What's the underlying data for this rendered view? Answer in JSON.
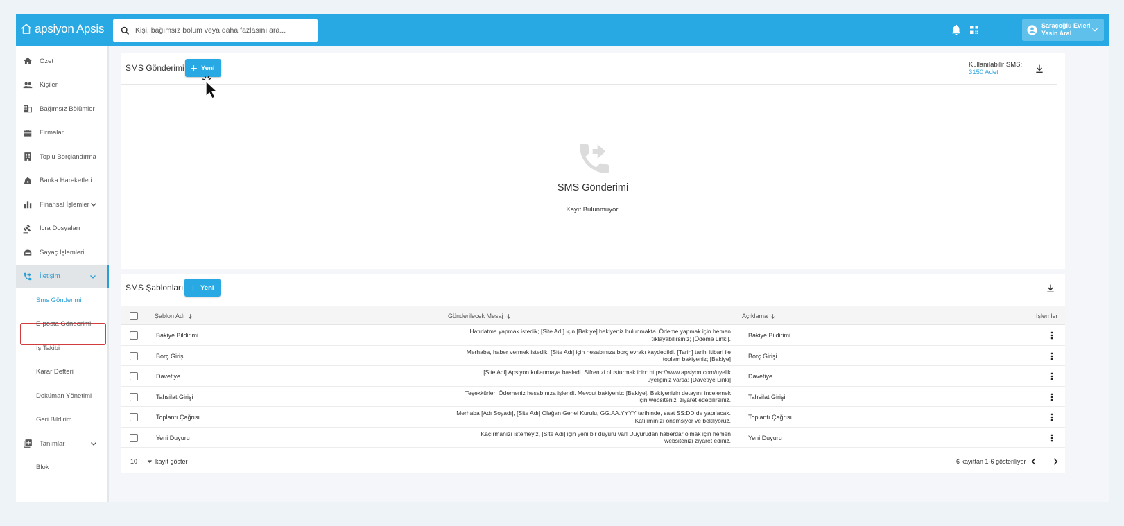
{
  "app": {
    "logo_text": "apsiyon Apsis",
    "search_placeholder": "Kişi, bağımsız bölüm veya daha fazlasını ara...",
    "site_name": "Saraçoğlu Evleri",
    "user_name": "Yasin Aral",
    "accent_color": "#29a9e3"
  },
  "sidebar": {
    "items": [
      {
        "label": "Özet",
        "icon": "home-icon"
      },
      {
        "label": "Kişiler",
        "icon": "people-icon"
      },
      {
        "label": "Bağımsız Bölümler",
        "icon": "building-icon"
      },
      {
        "label": "Firmalar",
        "icon": "briefcase-icon"
      },
      {
        "label": "Toplu Borçlandırma",
        "icon": "office-icon"
      },
      {
        "label": "Banka Hareketleri",
        "icon": "bank-icon"
      },
      {
        "label": "Finansal İşlemler",
        "icon": "chart-icon"
      },
      {
        "label": "İcra Dosyaları",
        "icon": "gavel-icon"
      },
      {
        "label": "Sayaç İşlemleri",
        "icon": "meter-icon"
      },
      {
        "label": "İletişim",
        "icon": "phone-icon"
      },
      {
        "label": "Tanımlar",
        "icon": "add-box-icon"
      }
    ],
    "sub_items": [
      {
        "label": "Sms Gönderimi"
      },
      {
        "label": "E-posta Gönderimi"
      },
      {
        "label": "İş Takibi"
      },
      {
        "label": "Karar Defteri"
      },
      {
        "label": "Doküman Yönetimi"
      },
      {
        "label": "Geri Bildirim"
      },
      {
        "label": "Blok"
      }
    ]
  },
  "sms_panel": {
    "title": "SMS Gönderimi",
    "new_label": "Yeni",
    "available_label": "Kullanılabilir SMS:",
    "available_count": "3150 Adet",
    "empty_title": "SMS Gönderimi",
    "empty_text": "Kayıt Bulunmuyor."
  },
  "templates_panel": {
    "title": "SMS Şablonları",
    "new_label": "Yeni",
    "columns": {
      "name": "Şablon Adı",
      "message": "Gönderilecek Mesaj",
      "description": "Açıklama",
      "actions": "İşlemler"
    },
    "rows": [
      {
        "name": "Bakiye Bildirimi",
        "msg1": "Hatırlatma yapmak istedik; [Site Adı] için [Bakiye] bakiyeniz bulunmakta. Ödeme yapmak için hemen",
        "msg2": "tıklayabilirsiniz; [Ödeme Linki].",
        "desc": "Bakiye Bildirimi"
      },
      {
        "name": "Borç Girişi",
        "msg1": "Merhaba, haber vermek istedik; [Site Adı] için hesabınıza borç evrakı kaydedildi. [Tarih] tarihi itibari ile",
        "msg2": "toplam bakiyeniz; [Bakiye]",
        "desc": "Borç Girişi"
      },
      {
        "name": "Davetiye",
        "msg1": "[Site Adi] Apsiyon kullanmaya basladi. Sifrenizi olusturmak icin: https://www.apsiyon.com/uyelik",
        "msg2": "uyeliginiz varsa: [Davetiye Linki]",
        "desc": "Davetiye"
      },
      {
        "name": "Tahsilat Girişi",
        "msg1": "Teşekkürler! Ödemeniz hesabınıza işlendi. Mevcut bakiyeniz: [Bakiye]. Bakiyenizin detayını incelemek",
        "msg2": "için websitenizi ziyaret edebilirsiniz.",
        "desc": "Tahsilat Girişi"
      },
      {
        "name": "Toplantı Çağrısı",
        "msg1": "Merhaba [Adı Soyadı], [Site Adı] Olağan Genel Kurulu, GG.AA.YYYY tarihinde, saat SS:DD de yapılacak.",
        "msg2": "Katılımınızı önemsiyor ve bekliyoruz.",
        "desc": "Toplantı Çağrısı"
      },
      {
        "name": "Yeni Duyuru",
        "msg1": "Kaçırmanızı istemeyiz, [Site Adı] için yeni bir duyuru var! Duyurudan haberdar olmak için hemen",
        "msg2": "websitenizi ziyaret ediniz.",
        "desc": "Yeni Duyuru"
      }
    ],
    "page_size": "10",
    "page_size_label": "kayıt göster",
    "page_info": "6 kayıttan 1-6 gösteriliyor"
  }
}
